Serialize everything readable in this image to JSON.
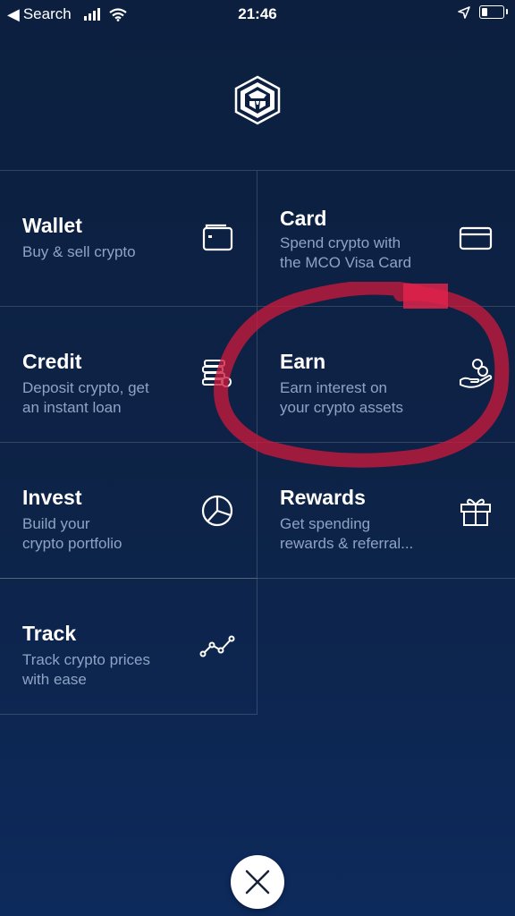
{
  "status_bar": {
    "back_label": "Search",
    "time": "21:46",
    "icons": [
      "back-arrow-icon",
      "signal-icon",
      "wifi-icon",
      "location-icon",
      "battery-icon"
    ]
  },
  "logo": {
    "name": "app-logo-icon"
  },
  "menu": {
    "items": [
      {
        "title": "Wallet",
        "subtitle": "Buy & sell crypto",
        "icon": "wallet-icon"
      },
      {
        "title": "Card",
        "subtitle": "Spend crypto with\nthe MCO Visa Card",
        "icon": "card-icon"
      },
      {
        "title": "Credit",
        "subtitle": "Deposit crypto, get\nan instant loan",
        "icon": "coins-stack-icon"
      },
      {
        "title": "Earn",
        "subtitle": "Earn interest on\nyour crypto assets",
        "icon": "hand-coins-icon"
      },
      {
        "title": "Invest",
        "subtitle": "Build your\ncrypto portfolio",
        "icon": "pie-chart-icon"
      },
      {
        "title": "Rewards",
        "subtitle": "Get spending\nrewards & referral...",
        "icon": "gift-icon"
      },
      {
        "title": "Track",
        "subtitle": "Track crypto prices\nwith ease",
        "icon": "trend-line-icon"
      }
    ]
  },
  "close_button": {
    "icon": "close-icon"
  },
  "colors": {
    "background_top": "#0c1f3f",
    "background_bottom": "#0d2a5c",
    "subtitle": "#8fa3c4",
    "annotation": "#c8193c"
  }
}
